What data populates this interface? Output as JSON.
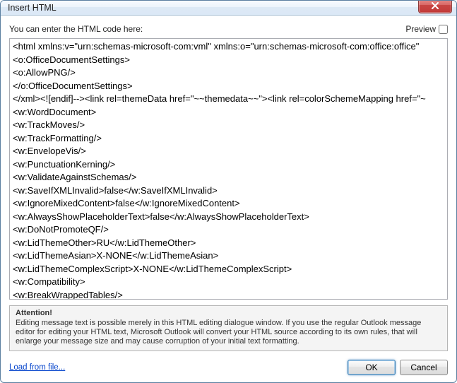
{
  "window": {
    "title": "Insert HTML"
  },
  "labels": {
    "prompt": "You can enter the HTML code here:",
    "preview": "Preview"
  },
  "editor": {
    "value": "<html xmlns:v=\"urn:schemas-microsoft-com:vml\" xmlns:o=\"urn:schemas-microsoft-com:office:office\" \n<o:OfficeDocumentSettings>\n<o:AllowPNG/>\n</o:OfficeDocumentSettings>\n</xml><![endif]--><link rel=themeData href=\"~~themedata~~\"><link rel=colorSchemeMapping href=\"~\n<w:WordDocument>\n<w:TrackMoves/>\n<w:TrackFormatting/>\n<w:EnvelopeVis/>\n<w:PunctuationKerning/>\n<w:ValidateAgainstSchemas/>\n<w:SaveIfXMLInvalid>false</w:SaveIfXMLInvalid>\n<w:IgnoreMixedContent>false</w:IgnoreMixedContent>\n<w:AlwaysShowPlaceholderText>false</w:AlwaysShowPlaceholderText>\n<w:DoNotPromoteQF/>\n<w:LidThemeOther>RU</w:LidThemeOther>\n<w:LidThemeAsian>X-NONE</w:LidThemeAsian>\n<w:LidThemeComplexScript>X-NONE</w:LidThemeComplexScript>\n<w:Compatibility>\n<w:BreakWrappedTables/>"
  },
  "attention": {
    "title": "Attention!",
    "body": "Editing message text is possible merely in this HTML editing dialogue window. If you use the regular Outlook message editor for editing your HTML text, Microsoft Outlook will convert your HTML source according to its own rules, that will enlarge your message size and may cause corruption of your initial text formatting."
  },
  "footer": {
    "loadFromFile": "Load from file...",
    "ok": "OK",
    "cancel": "Cancel"
  }
}
